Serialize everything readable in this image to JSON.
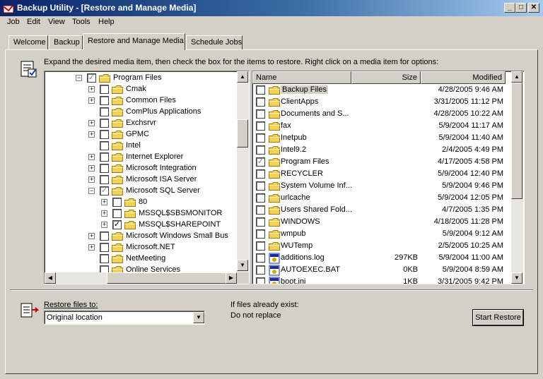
{
  "window": {
    "title": "Backup Utility - [Restore and Manage Media]",
    "minimize": "_",
    "maximize": "□",
    "close": "✕"
  },
  "menu": [
    "Job",
    "Edit",
    "View",
    "Tools",
    "Help"
  ],
  "tabs": [
    "Welcome",
    "Backup",
    "Restore and Manage Media",
    "Schedule Jobs"
  ],
  "active_tab": "Restore and Manage Media",
  "instructions": "Expand the desired media item, then check the box for the items to restore. Right click on a media item for options:",
  "tree": [
    {
      "label": "Program Files",
      "level": 0,
      "expander": "−",
      "check": "gray"
    },
    {
      "label": "Cmak",
      "level": 1,
      "expander": "+",
      "check": "none"
    },
    {
      "label": "Common Files",
      "level": 1,
      "expander": "+",
      "check": "none"
    },
    {
      "label": "ComPlus Applications",
      "level": 1,
      "expander": "",
      "check": "none"
    },
    {
      "label": "Exchsrvr",
      "level": 1,
      "expander": "+",
      "check": "none"
    },
    {
      "label": "GPMC",
      "level": 1,
      "expander": "+",
      "check": "none"
    },
    {
      "label": "Intel",
      "level": 1,
      "expander": "",
      "check": "none"
    },
    {
      "label": "Internet Explorer",
      "level": 1,
      "expander": "+",
      "check": "none"
    },
    {
      "label": "Microsoft Integration",
      "level": 1,
      "expander": "+",
      "check": "none"
    },
    {
      "label": "Microsoft ISA Server",
      "level": 1,
      "expander": "+",
      "check": "none"
    },
    {
      "label": "Microsoft SQL Server",
      "level": 1,
      "expander": "−",
      "check": "gray"
    },
    {
      "label": "80",
      "level": 2,
      "expander": "+",
      "check": "none"
    },
    {
      "label": "MSSQL$SBSMONITOR",
      "level": 2,
      "expander": "+",
      "check": "none"
    },
    {
      "label": "MSSQL$SHAREPOINT",
      "level": 2,
      "expander": "+",
      "check": "checked"
    },
    {
      "label": "Microsoft Windows Small Bus",
      "level": 1,
      "expander": "+",
      "check": "none"
    },
    {
      "label": "Microsoft.NET",
      "level": 1,
      "expander": "+",
      "check": "none"
    },
    {
      "label": "NetMeeting",
      "level": 1,
      "expander": "",
      "check": "none"
    },
    {
      "label": "Online Services",
      "level": 1,
      "expander": "",
      "check": "none"
    }
  ],
  "list": {
    "columns": {
      "name": "Name",
      "size": "Size",
      "modified": "Modified"
    },
    "rows": [
      {
        "name": "Backup Files",
        "size": "",
        "modified": "4/28/2005 9:46 AM",
        "type": "folder",
        "check": "none",
        "selected": true
      },
      {
        "name": "ClientApps",
        "size": "",
        "modified": "3/31/2005 11:12 PM",
        "type": "folder",
        "check": "none"
      },
      {
        "name": "Documents and S...",
        "size": "",
        "modified": "4/28/2005 10:22 AM",
        "type": "folder",
        "check": "none"
      },
      {
        "name": "fax",
        "size": "",
        "modified": "5/9/2004 11:17 AM",
        "type": "folder",
        "check": "none"
      },
      {
        "name": "Inetpub",
        "size": "",
        "modified": "5/9/2004 11:40 AM",
        "type": "folder",
        "check": "none"
      },
      {
        "name": "Intel9.2",
        "size": "",
        "modified": "2/4/2005 4:49 PM",
        "type": "folder",
        "check": "none"
      },
      {
        "name": "Program Files",
        "size": "",
        "modified": "4/17/2005 4:58 PM",
        "type": "folder",
        "check": "gray"
      },
      {
        "name": "RECYCLER",
        "size": "",
        "modified": "5/9/2004 12:40 PM",
        "type": "folder",
        "check": "none"
      },
      {
        "name": "System Volume Inf...",
        "size": "",
        "modified": "5/9/2004 9:46 PM",
        "type": "folder",
        "check": "none"
      },
      {
        "name": "urlcache",
        "size": "",
        "modified": "5/9/2004 12:05 PM",
        "type": "folder",
        "check": "none"
      },
      {
        "name": "Users Shared Fold...",
        "size": "",
        "modified": "4/7/2005 1:35 PM",
        "type": "folder",
        "check": "none"
      },
      {
        "name": "WINDOWS",
        "size": "",
        "modified": "4/18/2005 11:28 PM",
        "type": "folder",
        "check": "none"
      },
      {
        "name": "wmpub",
        "size": "",
        "modified": "5/9/2004 9:12 AM",
        "type": "folder",
        "check": "none"
      },
      {
        "name": "WUTemp",
        "size": "",
        "modified": "2/5/2005 10:25 AM",
        "type": "folder",
        "check": "none"
      },
      {
        "name": "additions.log",
        "size": "297KB",
        "modified": "5/9/2004 11:00 AM",
        "type": "file",
        "check": "none"
      },
      {
        "name": "AUTOEXEC.BAT",
        "size": "0KB",
        "modified": "5/9/2004 8:59 AM",
        "type": "file",
        "check": "none"
      },
      {
        "name": "boot.ini",
        "size": "1KB",
        "modified": "3/31/2005 9:42 PM",
        "type": "file",
        "check": "none"
      }
    ]
  },
  "restore": {
    "label": "Restore files to:",
    "value": "Original location",
    "exist_label": "If files already exist:",
    "exist_value": "Do not replace",
    "start_button": "Start Restore"
  },
  "colors": {
    "title_start": "#0a246a",
    "title_end": "#a6caf0",
    "face": "#d4d0c8",
    "folder": "#f2d25a"
  }
}
